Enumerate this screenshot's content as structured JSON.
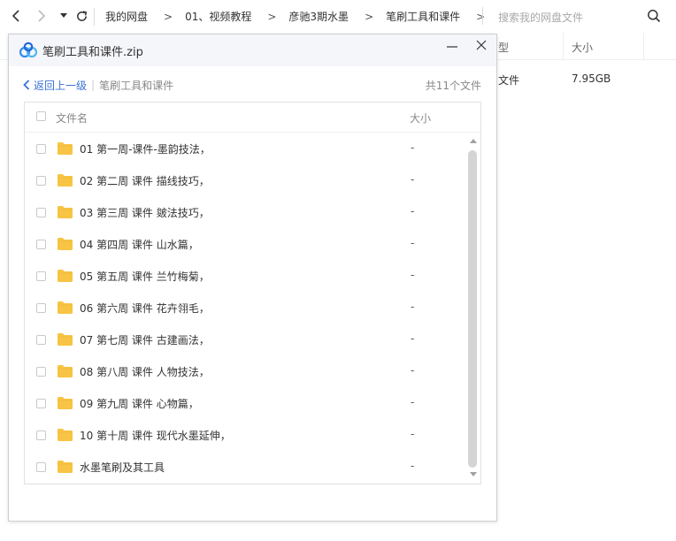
{
  "topbar": {
    "back_icon": "chevron-left-icon",
    "forward_icon": "chevron-right-icon",
    "dropdown_icon": "caret-down-icon",
    "refresh_icon": "refresh-icon",
    "breadcrumbs": [
      "我的网盘",
      "01、视频教程",
      "彦驰3期水墨",
      "笔刷工具和课件"
    ],
    "breadcrumb_separator": ">",
    "search_placeholder": "搜索我的网盘文件",
    "search_icon": "search-icon"
  },
  "background_list": {
    "columns": {
      "type": "型",
      "size": "大小"
    },
    "row": {
      "type": "文件",
      "size": "7.95GB"
    }
  },
  "dialog": {
    "title": "笔刷工具和课件.zip",
    "logo_icon": "baidu-netdisk-logo",
    "back_label": "返回上一级",
    "divider": "|",
    "current_folder": "笔刷工具和课件",
    "file_count": "共11个文件",
    "columns": {
      "name": "文件名",
      "size": "大小"
    },
    "files": [
      {
        "name": "01 第一周-课件-墨韵技法，",
        "size": "-"
      },
      {
        "name": "02 第二周 课件 描线技巧，",
        "size": "-"
      },
      {
        "name": "03 第三周 课件 皴法技巧，",
        "size": "-"
      },
      {
        "name": "04 第四周 课件 山水篇，",
        "size": "-"
      },
      {
        "name": "05 第五周 课件 兰竹梅菊，",
        "size": "-"
      },
      {
        "name": "06 第六周 课件 花卉翎毛，",
        "size": "-"
      },
      {
        "name": "07 第七周 课件 古建画法，",
        "size": "-"
      },
      {
        "name": "08 第八周 课件 人物技法，",
        "size": "-"
      },
      {
        "name": "09 第九周 课件 心物篇，",
        "size": "-"
      },
      {
        "name": "10 第十周 课件 现代水墨延伸，",
        "size": "-"
      },
      {
        "name": "水墨笔刷及其工具",
        "size": "-"
      }
    ],
    "colors": {
      "accent": "#3a73d4",
      "folder": "#f7c444",
      "titlebar": "#f5f6fa"
    }
  }
}
